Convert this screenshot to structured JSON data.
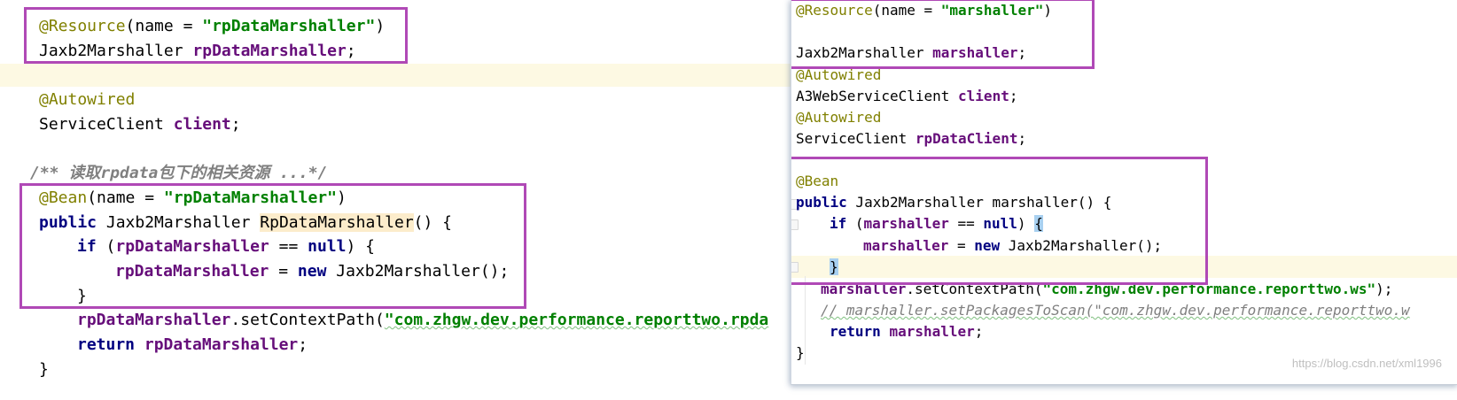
{
  "left_editor": {
    "line1": {
      "annotation": "@Resource",
      "p1": "(name = ",
      "string": "\"rpDataMarshaller\"",
      "p2": ")"
    },
    "line2": {
      "type": "Jaxb2Marshaller ",
      "field": "rpDataMarshaller",
      "semi": ";"
    },
    "line3": {
      "annotation": "@Autowired"
    },
    "line4": {
      "type": "ServiceClient ",
      "field": "client",
      "semi": ";"
    },
    "line5": {
      "comment": "/** 读取rpdata包下的相关资源 ...*/"
    },
    "line6": {
      "annotation": "@Bean",
      "p1": "(name = ",
      "string": "\"rpDataMarshaller\"",
      "p2": ")"
    },
    "line7": {
      "keyword": "public",
      "type": " Jaxb2Marshaller ",
      "method": "RpDataMarshaller",
      "rest": "() {"
    },
    "line8": {
      "keyword": "if",
      "p1": " (",
      "field": "rpDataMarshaller",
      "op": " == ",
      "null_kw": "null",
      "p2": ") {"
    },
    "line9": {
      "field": "rpDataMarshaller",
      "op": " = ",
      "new_kw": "new",
      "rest": " Jaxb2Marshaller();"
    },
    "line10": {
      "text": "}"
    },
    "line11": {
      "field": "rpDataMarshaller",
      "call": ".setContextPath(",
      "string": "\"com.zhgw.dev.performance.reporttwo.rpda"
    },
    "line12": {
      "keyword": "return",
      "sp": " ",
      "field": "rpDataMarshaller",
      "semi": ";"
    },
    "line13": {
      "text": "}"
    }
  },
  "right_editor": {
    "line1": {
      "annotation": "@Resource",
      "p1": "(name = ",
      "string": "\"marshaller\"",
      "p2": ")"
    },
    "line2": {
      "type": "Jaxb2Marshaller ",
      "field": "marshaller",
      "semi": ";"
    },
    "line3": {
      "annotation": "@Autowired"
    },
    "line4": {
      "type": "A3WebServiceClient ",
      "field": "client",
      "semi": ";"
    },
    "line5": {
      "annotation": "@Autowired"
    },
    "line6": {
      "type": "ServiceClient ",
      "field": "rpDataClient",
      "semi": ";"
    },
    "line7": {
      "annotation": "@Bean"
    },
    "line8": {
      "keyword": "public",
      "rest": " Jaxb2Marshaller marshaller() {"
    },
    "line9": {
      "keyword": "if",
      "p1": " (",
      "field": "marshaller",
      "op": " == ",
      "null_kw": "null",
      "p2": ") ",
      "brace": "{"
    },
    "line10": {
      "field": "marshaller",
      "op": " = ",
      "new_kw": "new",
      "rest": " Jaxb2Marshaller();"
    },
    "line11": {
      "brace": "}"
    },
    "line12": {
      "field": "marshaller",
      "call": ".setContextPath(",
      "string": "\"com.zhgw.dev.performance.reporttwo.ws\"",
      "rest": ");"
    },
    "line13": {
      "comment": "// marshaller.setPackagesToScan(\"com.zhgw.dev.performance.reporttwo.w"
    },
    "line14": {
      "keyword": "return",
      "sp": " ",
      "field": "marshaller",
      "semi": ";"
    },
    "line15": {
      "text": "}"
    }
  },
  "watermark": "https://blog.csdn.net/xml1996",
  "colors": {
    "annotation_box": "#b049b6",
    "caret_row": "#fdf9e3",
    "keyword": "#000080",
    "string": "#008000",
    "field": "#660e7a",
    "annotation": "#808000"
  }
}
